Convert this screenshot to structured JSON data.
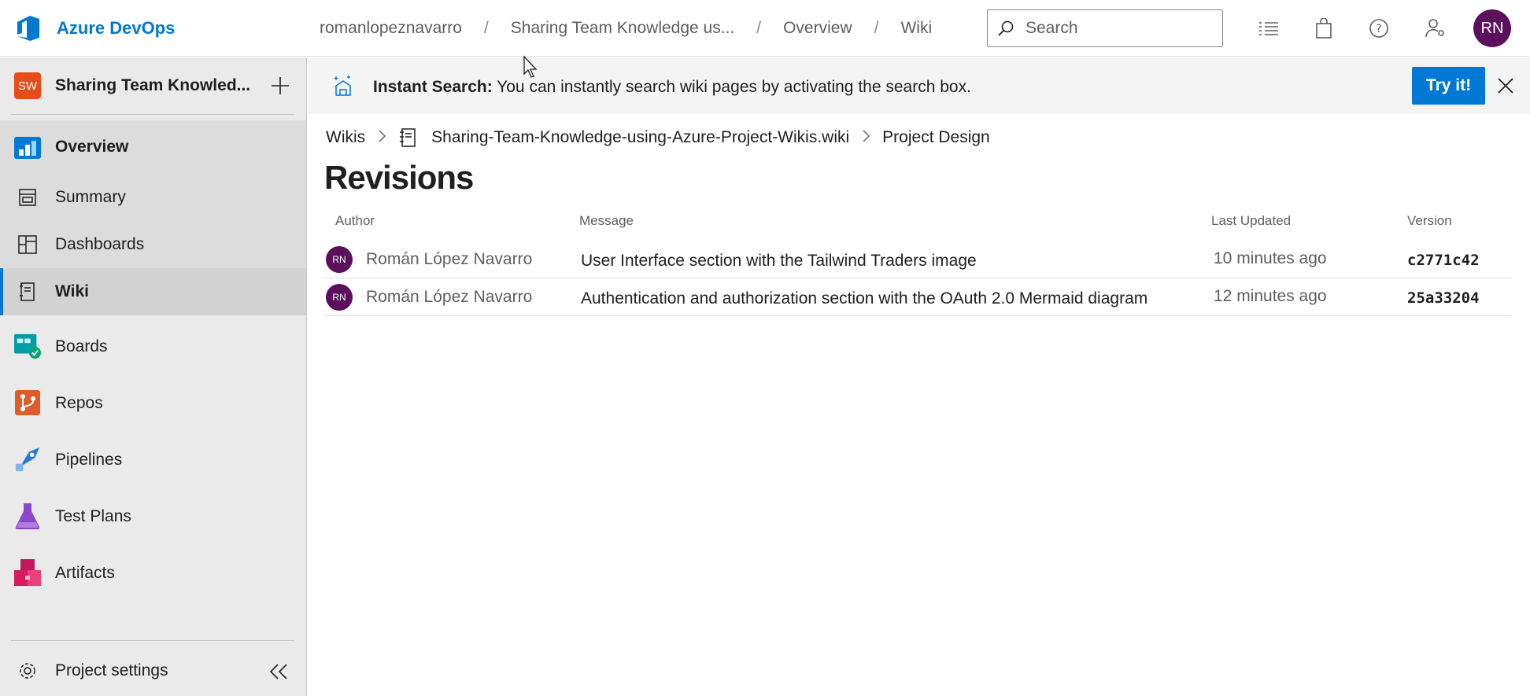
{
  "header": {
    "brand": "Azure DevOps",
    "breadcrumbs": [
      "romanlopeznavarro",
      "Sharing Team Knowledge us...",
      "Overview",
      "Wiki"
    ],
    "search_placeholder": "Search",
    "avatar_initials": "RN"
  },
  "sidebar": {
    "project_badge": "SW",
    "project_name": "Sharing Team Knowled...",
    "items": [
      {
        "label": "Overview",
        "icon": "overview-icon"
      },
      {
        "label": "Summary",
        "icon": "summary-icon"
      },
      {
        "label": "Dashboards",
        "icon": "dashboards-icon"
      },
      {
        "label": "Wiki",
        "icon": "wiki-icon"
      },
      {
        "label": "Boards",
        "icon": "boards-icon"
      },
      {
        "label": "Repos",
        "icon": "repos-icon"
      },
      {
        "label": "Pipelines",
        "icon": "pipelines-icon"
      },
      {
        "label": "Test Plans",
        "icon": "test-plans-icon"
      },
      {
        "label": "Artifacts",
        "icon": "artifacts-icon"
      }
    ],
    "settings_label": "Project settings"
  },
  "banner": {
    "bold": "Instant Search:",
    "text": " You can instantly search wiki pages by activating the search box.",
    "button": "Try it!"
  },
  "breadcrumb": {
    "wikis": "Wikis",
    "wiki_name": "Sharing-Team-Knowledge-using-Azure-Project-Wikis.wiki",
    "page": "Project Design"
  },
  "page_title": "Revisions",
  "table": {
    "columns": [
      "Author",
      "Message",
      "Last Updated",
      "Version"
    ],
    "rows": [
      {
        "initials": "RN",
        "author": "Román López Navarro",
        "message": "User Interface section with the Tailwind Traders image",
        "updated": "10 minutes ago",
        "version": "c2771c42"
      },
      {
        "initials": "RN",
        "author": "Román López Navarro",
        "message": "Authentication and authorization section with the OAuth 2.0 Mermaid diagram",
        "updated": "12 minutes ago",
        "version": "25a33204"
      }
    ]
  },
  "colors": {
    "accent": "#0078d4",
    "avatar": "#5c0f5c",
    "project_badge": "#e74c1b"
  }
}
